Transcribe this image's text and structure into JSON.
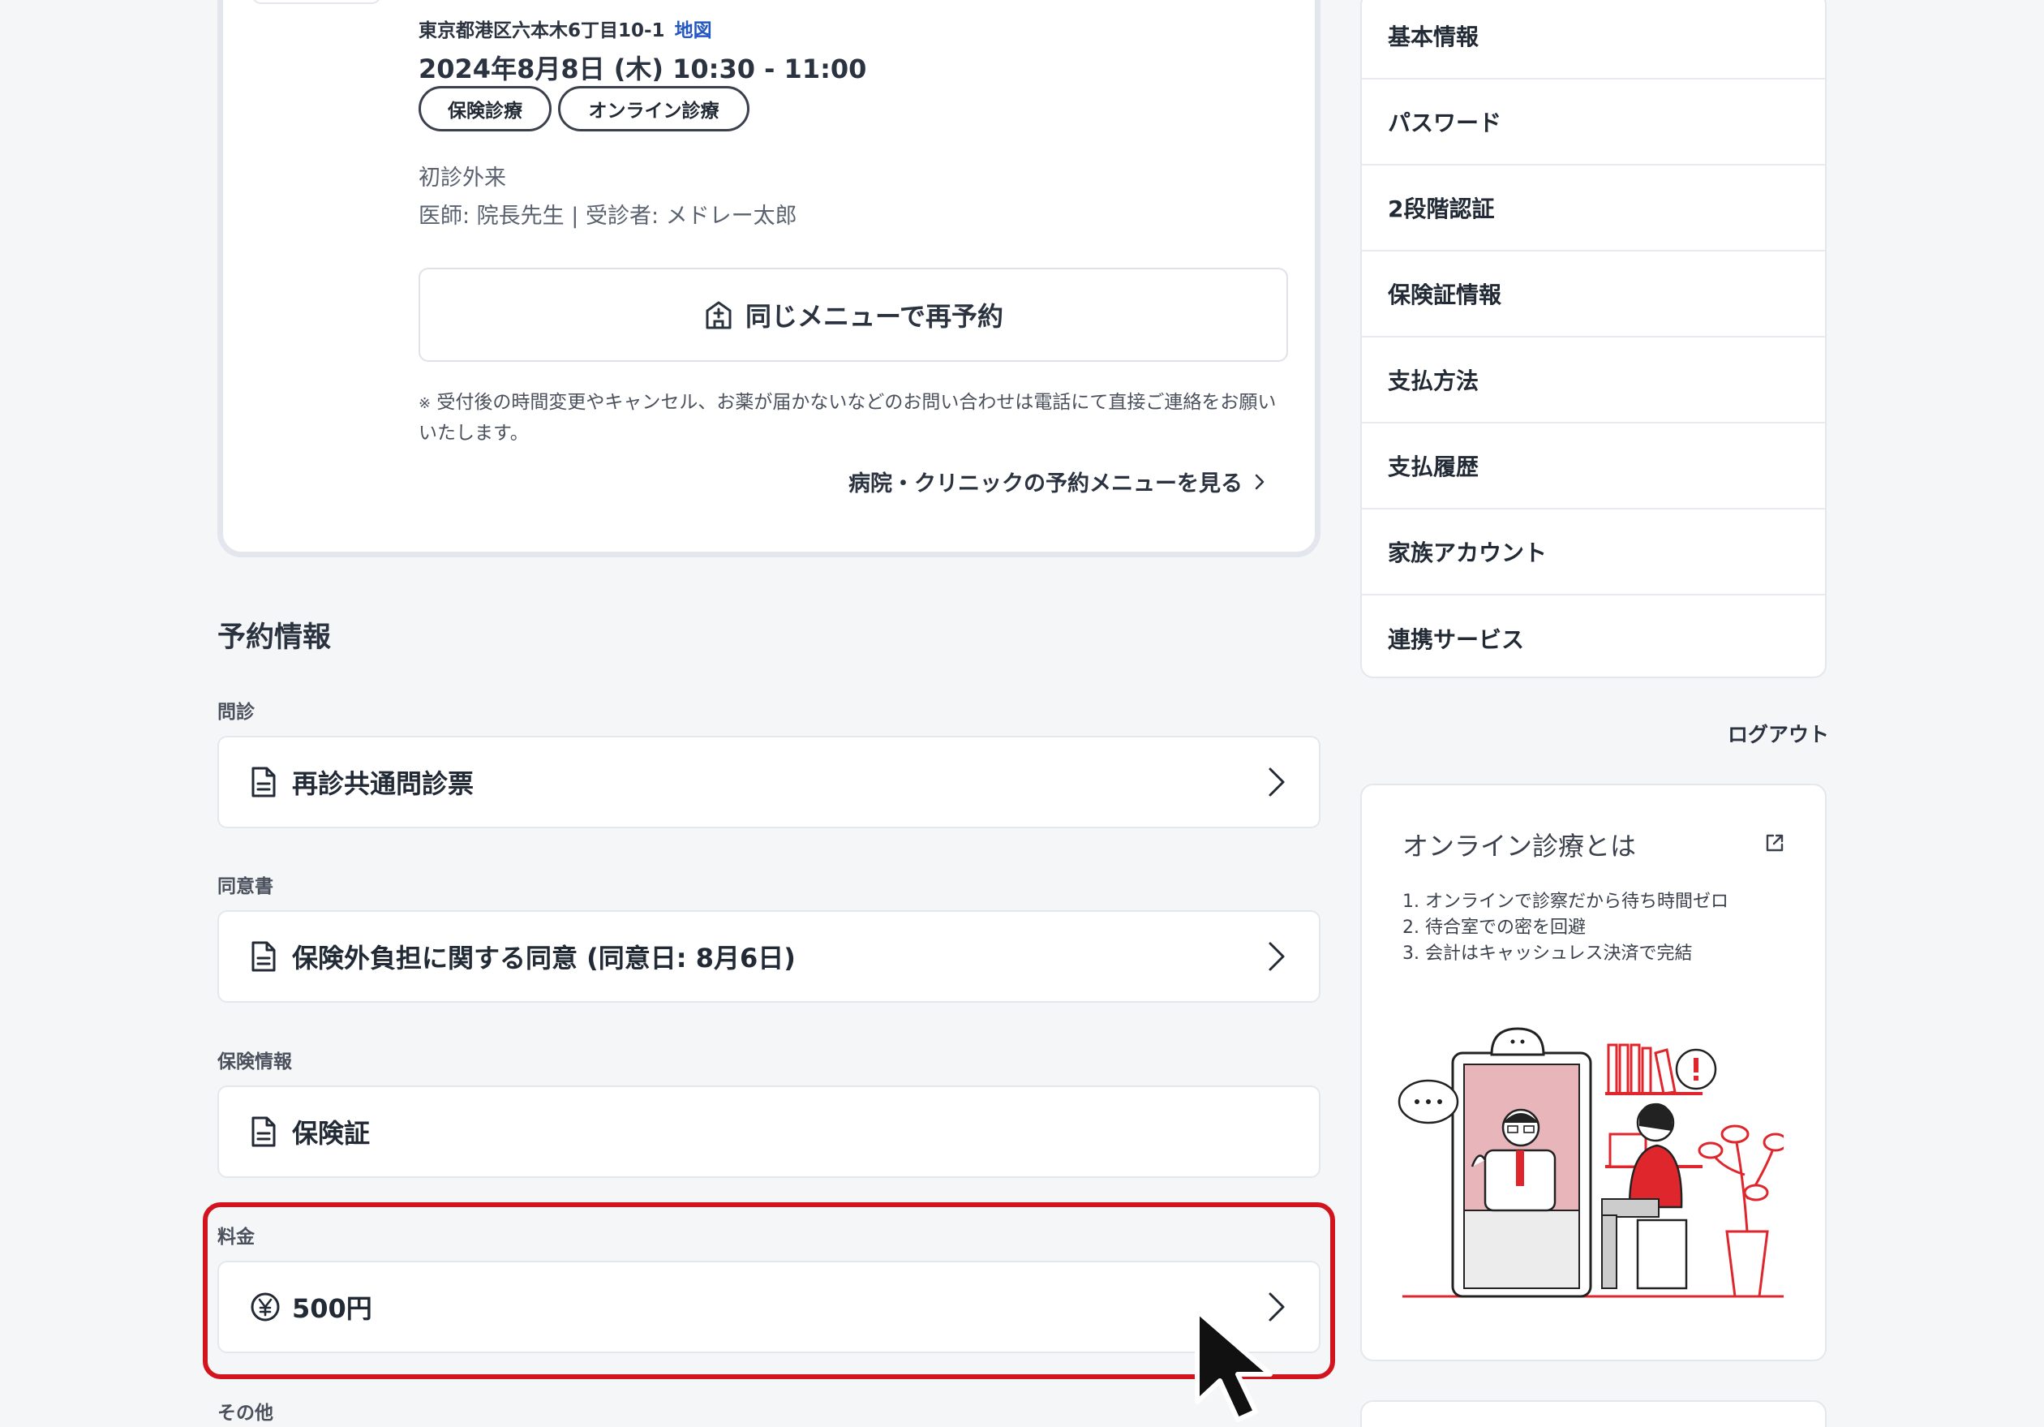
{
  "appointment": {
    "address": "東京都港区六本木6丁目10-1",
    "map_link": "地図",
    "datetime": "2024年8月8日 (木) 10:30 - 11:00",
    "tags": [
      "保険診療",
      "オンライン診療"
    ],
    "visit_type": "初診外来",
    "doctor_line": "医師: 院長先生 | 受診者: メドレー太郎",
    "rebook_label": "同じメニューで再予約",
    "note": "受付後の時間変更やキャンセル、お薬が届かないなどのお問い合わせは電話にて直接ご連絡をお願いいたします。",
    "note_mark": "※",
    "menu_link": "病院・クリニックの予約メニューを見る"
  },
  "reservation": {
    "title": "予約情報",
    "sections": [
      {
        "label": "問診",
        "item": "再診共通問診票",
        "icon": "document-icon"
      },
      {
        "label": "同意書",
        "item": "保険外負担に関する同意 (同意日: 8月6日)",
        "icon": "document-icon"
      },
      {
        "label": "保険情報",
        "item": "保険証",
        "icon": "document-icon"
      },
      {
        "label": "料金",
        "item": "500円",
        "icon": "yen-coin-icon"
      },
      {
        "label": "その他"
      }
    ]
  },
  "sidebar": {
    "items": [
      "基本情報",
      "パスワード",
      "2段階認証",
      "保険証情報",
      "支払方法",
      "支払履歴",
      "家族アカウント",
      "連携サービス"
    ],
    "logout": "ログアウト"
  },
  "promo": {
    "title": "オンライン診療とは",
    "points": [
      "1. オンラインで診察だから待ち時間ゼロ",
      "2. 待合室での密を回避",
      "3. 会計はキャッシュレス決済で完結"
    ]
  },
  "colors": {
    "highlight": "#d2141e",
    "link": "#2457c5",
    "illustration_red": "#e0262d"
  }
}
